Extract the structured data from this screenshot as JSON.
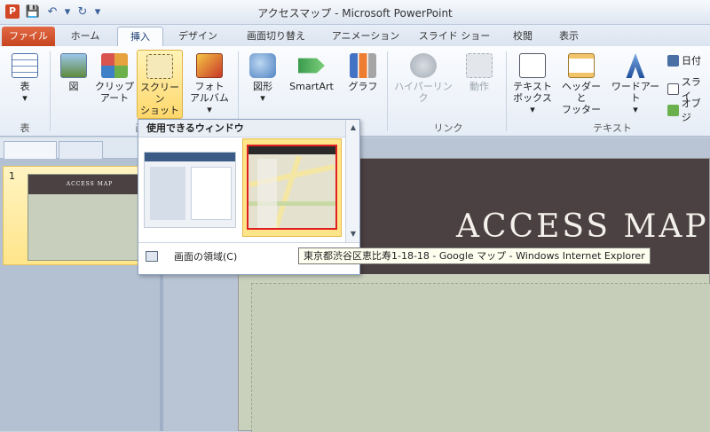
{
  "window": {
    "title": "アクセスマップ - Microsoft PowerPoint",
    "app_badge": "P"
  },
  "qat": {
    "save": "💾",
    "undo": "↶",
    "undo_drop": "▾",
    "redo": "↻",
    "customize": "▾"
  },
  "tabs": [
    {
      "label": "ファイル"
    },
    {
      "label": "ホーム"
    },
    {
      "label": "挿入"
    },
    {
      "label": "デザイン"
    },
    {
      "label": "画面切り替え"
    },
    {
      "label": "アニメーション"
    },
    {
      "label": "スライド ショー"
    },
    {
      "label": "校閲"
    },
    {
      "label": "表示"
    }
  ],
  "ribbon": {
    "table": {
      "label": "表",
      "drop": "▾",
      "group": "表"
    },
    "picture": {
      "label": "図"
    },
    "clipart": {
      "label1": "クリップ",
      "label2": "アート"
    },
    "screenshot": {
      "label1": "スクリーン",
      "label2": "ショット ▾"
    },
    "photoalbum": {
      "label1": "フォト",
      "label2": "アルバム ▾"
    },
    "images_group": "画",
    "shapes": {
      "label": "図形",
      "drop": "▾"
    },
    "smartart": {
      "label": "SmartArt"
    },
    "chart": {
      "label": "グラフ"
    },
    "hyperlink": {
      "label": "ハイパーリンク"
    },
    "action": {
      "label": "動作"
    },
    "links_group": "リンク",
    "textbox": {
      "label1": "テキスト",
      "label2": "ボックス ▾"
    },
    "headerfooter": {
      "label1": "ヘッダーと",
      "label2": "フッター"
    },
    "wordart": {
      "label": "ワードアート",
      "drop": "▾"
    },
    "text_group": "テキスト",
    "datetime": {
      "label": "日付"
    },
    "slidenum": {
      "label": "スライ"
    },
    "object": {
      "label": "オブジ"
    }
  },
  "thumbnails": {
    "slide_number": "1",
    "thumb_title": "ACCESS  MAP"
  },
  "slide": {
    "title": "ACCESS MAP"
  },
  "dropdown": {
    "header": "使用できるウィンドウ",
    "scroll_up": "▲",
    "scroll_down": "▼",
    "clip_label": "画面の領域(C)"
  },
  "tooltip": {
    "text": "東京都渋谷区恵比寿1-18-18 - Google マップ - Windows Internet Explorer"
  },
  "colors": {
    "accent_file": "#d24726",
    "slide_band": "#4b4142",
    "slide_bg": "#c9d0bc",
    "selection": "#ffd86b",
    "highlight_border": "#e02020"
  }
}
